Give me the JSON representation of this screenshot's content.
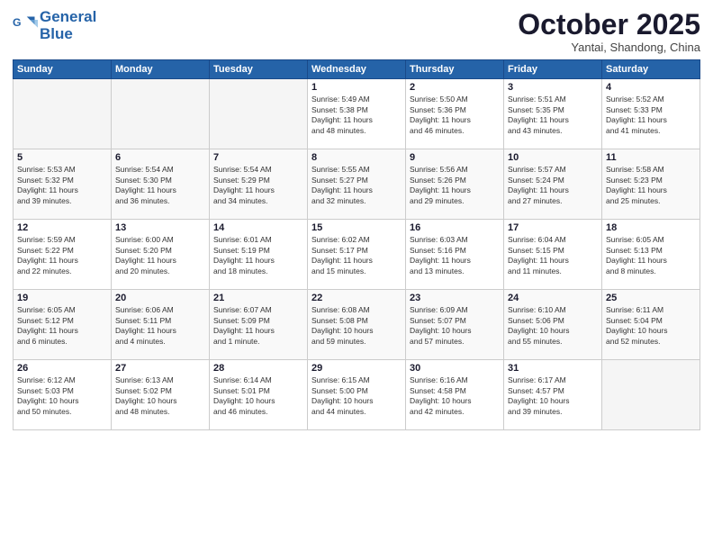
{
  "header": {
    "logo_line1": "General",
    "logo_line2": "Blue",
    "month": "October 2025",
    "location": "Yantai, Shandong, China"
  },
  "days_of_week": [
    "Sunday",
    "Monday",
    "Tuesday",
    "Wednesday",
    "Thursday",
    "Friday",
    "Saturday"
  ],
  "weeks": [
    [
      {
        "day": "",
        "empty": true
      },
      {
        "day": "",
        "empty": true
      },
      {
        "day": "",
        "empty": true
      },
      {
        "day": "1",
        "info": "Sunrise: 5:49 AM\nSunset: 5:38 PM\nDaylight: 11 hours\nand 48 minutes."
      },
      {
        "day": "2",
        "info": "Sunrise: 5:50 AM\nSunset: 5:36 PM\nDaylight: 11 hours\nand 46 minutes."
      },
      {
        "day": "3",
        "info": "Sunrise: 5:51 AM\nSunset: 5:35 PM\nDaylight: 11 hours\nand 43 minutes."
      },
      {
        "day": "4",
        "info": "Sunrise: 5:52 AM\nSunset: 5:33 PM\nDaylight: 11 hours\nand 41 minutes."
      }
    ],
    [
      {
        "day": "5",
        "info": "Sunrise: 5:53 AM\nSunset: 5:32 PM\nDaylight: 11 hours\nand 39 minutes."
      },
      {
        "day": "6",
        "info": "Sunrise: 5:54 AM\nSunset: 5:30 PM\nDaylight: 11 hours\nand 36 minutes."
      },
      {
        "day": "7",
        "info": "Sunrise: 5:54 AM\nSunset: 5:29 PM\nDaylight: 11 hours\nand 34 minutes."
      },
      {
        "day": "8",
        "info": "Sunrise: 5:55 AM\nSunset: 5:27 PM\nDaylight: 11 hours\nand 32 minutes."
      },
      {
        "day": "9",
        "info": "Sunrise: 5:56 AM\nSunset: 5:26 PM\nDaylight: 11 hours\nand 29 minutes."
      },
      {
        "day": "10",
        "info": "Sunrise: 5:57 AM\nSunset: 5:24 PM\nDaylight: 11 hours\nand 27 minutes."
      },
      {
        "day": "11",
        "info": "Sunrise: 5:58 AM\nSunset: 5:23 PM\nDaylight: 11 hours\nand 25 minutes."
      }
    ],
    [
      {
        "day": "12",
        "info": "Sunrise: 5:59 AM\nSunset: 5:22 PM\nDaylight: 11 hours\nand 22 minutes."
      },
      {
        "day": "13",
        "info": "Sunrise: 6:00 AM\nSunset: 5:20 PM\nDaylight: 11 hours\nand 20 minutes."
      },
      {
        "day": "14",
        "info": "Sunrise: 6:01 AM\nSunset: 5:19 PM\nDaylight: 11 hours\nand 18 minutes."
      },
      {
        "day": "15",
        "info": "Sunrise: 6:02 AM\nSunset: 5:17 PM\nDaylight: 11 hours\nand 15 minutes."
      },
      {
        "day": "16",
        "info": "Sunrise: 6:03 AM\nSunset: 5:16 PM\nDaylight: 11 hours\nand 13 minutes."
      },
      {
        "day": "17",
        "info": "Sunrise: 6:04 AM\nSunset: 5:15 PM\nDaylight: 11 hours\nand 11 minutes."
      },
      {
        "day": "18",
        "info": "Sunrise: 6:05 AM\nSunset: 5:13 PM\nDaylight: 11 hours\nand 8 minutes."
      }
    ],
    [
      {
        "day": "19",
        "info": "Sunrise: 6:05 AM\nSunset: 5:12 PM\nDaylight: 11 hours\nand 6 minutes."
      },
      {
        "day": "20",
        "info": "Sunrise: 6:06 AM\nSunset: 5:11 PM\nDaylight: 11 hours\nand 4 minutes."
      },
      {
        "day": "21",
        "info": "Sunrise: 6:07 AM\nSunset: 5:09 PM\nDaylight: 11 hours\nand 1 minute."
      },
      {
        "day": "22",
        "info": "Sunrise: 6:08 AM\nSunset: 5:08 PM\nDaylight: 10 hours\nand 59 minutes."
      },
      {
        "day": "23",
        "info": "Sunrise: 6:09 AM\nSunset: 5:07 PM\nDaylight: 10 hours\nand 57 minutes."
      },
      {
        "day": "24",
        "info": "Sunrise: 6:10 AM\nSunset: 5:06 PM\nDaylight: 10 hours\nand 55 minutes."
      },
      {
        "day": "25",
        "info": "Sunrise: 6:11 AM\nSunset: 5:04 PM\nDaylight: 10 hours\nand 52 minutes."
      }
    ],
    [
      {
        "day": "26",
        "info": "Sunrise: 6:12 AM\nSunset: 5:03 PM\nDaylight: 10 hours\nand 50 minutes."
      },
      {
        "day": "27",
        "info": "Sunrise: 6:13 AM\nSunset: 5:02 PM\nDaylight: 10 hours\nand 48 minutes."
      },
      {
        "day": "28",
        "info": "Sunrise: 6:14 AM\nSunset: 5:01 PM\nDaylight: 10 hours\nand 46 minutes."
      },
      {
        "day": "29",
        "info": "Sunrise: 6:15 AM\nSunset: 5:00 PM\nDaylight: 10 hours\nand 44 minutes."
      },
      {
        "day": "30",
        "info": "Sunrise: 6:16 AM\nSunset: 4:58 PM\nDaylight: 10 hours\nand 42 minutes."
      },
      {
        "day": "31",
        "info": "Sunrise: 6:17 AM\nSunset: 4:57 PM\nDaylight: 10 hours\nand 39 minutes."
      },
      {
        "day": "",
        "empty": true
      }
    ]
  ]
}
